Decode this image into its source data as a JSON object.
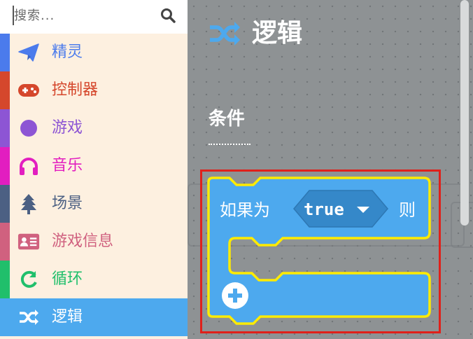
{
  "search": {
    "placeholder": "搜索...",
    "icon": "search-icon"
  },
  "sidebar": {
    "items": [
      {
        "label": "精灵",
        "color": "#4b7bec",
        "icon": "paper-plane-icon"
      },
      {
        "label": "控制器",
        "color": "#d5472c",
        "icon": "gamepad-icon"
      },
      {
        "label": "游戏",
        "color": "#8d55d4",
        "icon": "circle-icon"
      },
      {
        "label": "音乐",
        "color": "#e21ec0",
        "icon": "headphones-icon"
      },
      {
        "label": "场景",
        "color": "#4c6083",
        "icon": "tree-icon"
      },
      {
        "label": "游戏信息",
        "color": "#d0617f",
        "icon": "id-card-icon"
      },
      {
        "label": "循环",
        "color": "#20bf6b",
        "icon": "refresh-icon"
      },
      {
        "label": "逻辑",
        "color": "#4da9ee",
        "icon": "shuffle-icon",
        "selected": true
      }
    ]
  },
  "flyout": {
    "title": "逻辑",
    "title_icon": "shuffle-icon",
    "section_label": "条件",
    "block": {
      "prefix": "如果为",
      "value": "true",
      "suffix": "则",
      "add_icon": "plus-circle-icon",
      "color": "#4da9ee",
      "outline_color": "#ffeb00"
    },
    "highlight_color": "#e0201a"
  }
}
